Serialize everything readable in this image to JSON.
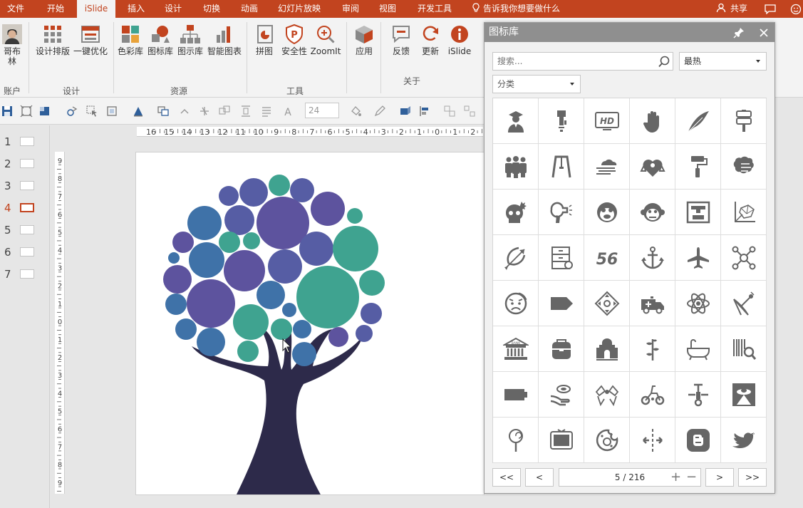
{
  "menubar": {
    "tabs": [
      "文件",
      "开始",
      "iSlide",
      "插入",
      "设计",
      "切换",
      "动画",
      "幻灯片放映",
      "审阅",
      "视图",
      "开发工具"
    ],
    "active_tab": "iSlide",
    "tell_me": "告诉我你想要做什么",
    "share": "共享"
  },
  "ribbon": {
    "account": {
      "user_name": "哥布林",
      "group_label": "账户"
    },
    "design": {
      "buttons": [
        "设计排版",
        "一键优化"
      ],
      "group_label": "设计"
    },
    "resources": {
      "buttons": [
        "色彩库",
        "图标库",
        "图示库",
        "智能图表"
      ],
      "group_label": "资源"
    },
    "tools": {
      "buttons": [
        "拼图",
        "安全性",
        "ZoomIt",
        "应用"
      ],
      "group_label": "工具"
    },
    "about": {
      "buttons": [
        "反馈",
        "更新",
        "iSlide"
      ],
      "group_label": "关于"
    }
  },
  "toolbar": {
    "font_size": "24"
  },
  "ruler": {
    "h_ticks": [
      "16",
      "15",
      "14",
      "13",
      "12",
      "11",
      "10",
      "9",
      "8",
      "7",
      "6",
      "5",
      "4",
      "3",
      "2",
      "1",
      "0",
      "1",
      "2"
    ],
    "v_ticks": [
      "9",
      "8",
      "7",
      "6",
      "5",
      "4",
      "3",
      "2",
      "1",
      "0",
      "1",
      "2",
      "3",
      "4",
      "5",
      "6",
      "7",
      "8",
      "9"
    ]
  },
  "thumbnails": {
    "items": [
      "1",
      "2",
      "3",
      "4",
      "5",
      "6",
      "7"
    ],
    "active": "4"
  },
  "colors": {
    "accent": "#c2441f",
    "icon_gray": "#666666",
    "trunk": "#2d2a4a",
    "teal": "#3fa390",
    "purple": "#5d539e",
    "blue": "#3f72a8",
    "indigo": "#565da4"
  },
  "icon_panel": {
    "title": "图标库",
    "search_placeholder": "搜索...",
    "sort": "最热",
    "category": "分类",
    "icons": [
      "graduate-person-icon",
      "usb-stick-icon",
      "hd-monitor-icon",
      "hand-stop-icon",
      "feather-icon",
      "road-sign-icon",
      "people-group-icon",
      "swing-frame-icon",
      "wind-clouds-icon",
      "heart-bow-icon",
      "paint-roller-icon",
      "brain-lines-icon",
      "skull-explosion-icon",
      "hair-dryer-icon",
      "chimp-face-icon",
      "monkey-face-icon",
      "3d-printer-icon",
      "3d-axes-icon",
      "cupid-bow-icon",
      "drawer-cabinet-icon",
      "number-56-icon",
      "anchor-icon",
      "airplane-icon",
      "molecule-network-icon",
      "sad-face-icon",
      "price-tag-icon",
      "direction-pad-icon",
      "ambulance-icon",
      "atom-icon",
      "satellite-dish-icon",
      "bank-building-icon",
      "backpack-icon",
      "arch-temple-icon",
      "branch-plant-icon",
      "bathtub-icon",
      "barcode-search-icon",
      "battery-icon",
      "hand-coin-icon",
      "ribbon-bows-icon",
      "tricycle-icon",
      "scooter-icon",
      "ufo-frame-icon",
      "lollipop-icon",
      "tv-frame-icon",
      "cookie-icon",
      "split-arrows-icon",
      "blogger-icon",
      "twitter-bird-icon"
    ],
    "pager": {
      "first": "<<",
      "prev": "<",
      "page_info": "5 / 216",
      "next": ">",
      "last": ">>",
      "zoom_in": "+",
      "zoom_out": "−"
    }
  }
}
